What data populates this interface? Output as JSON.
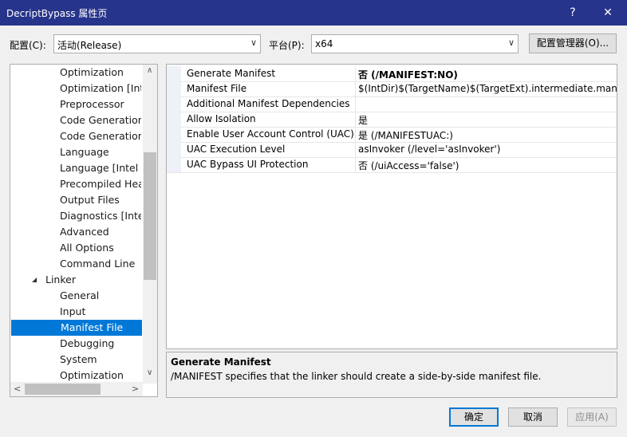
{
  "window": {
    "title": "DecriptBypass 属性页",
    "help_button": "?",
    "close_button": "✕"
  },
  "config": {
    "config_label": "配置(C):",
    "config_value": "活动(Release)",
    "platform_label": "平台(P):",
    "platform_value": "x64",
    "manager_button": "配置管理器(O)..."
  },
  "tree": {
    "items": [
      {
        "label": "Optimization",
        "indent": 2
      },
      {
        "label": "Optimization [Inte",
        "indent": 2
      },
      {
        "label": "Preprocessor",
        "indent": 2
      },
      {
        "label": "Code Generation",
        "indent": 2
      },
      {
        "label": "Code Generation",
        "indent": 2
      },
      {
        "label": "Language",
        "indent": 2
      },
      {
        "label": "Language [Intel C",
        "indent": 2
      },
      {
        "label": "Precompiled Head",
        "indent": 2
      },
      {
        "label": "Output Files",
        "indent": 2
      },
      {
        "label": "Diagnostics [Intel",
        "indent": 2
      },
      {
        "label": "Advanced",
        "indent": 2
      },
      {
        "label": "All Options",
        "indent": 2
      },
      {
        "label": "Command Line",
        "indent": 2
      },
      {
        "label": "Linker",
        "indent": 1,
        "expander": "◢"
      },
      {
        "label": "General",
        "indent": 2
      },
      {
        "label": "Input",
        "indent": 2
      },
      {
        "label": "Manifest File",
        "indent": 2,
        "selected": true
      },
      {
        "label": "Debugging",
        "indent": 2
      },
      {
        "label": "System",
        "indent": 2
      },
      {
        "label": "Optimization",
        "indent": 2
      }
    ]
  },
  "properties": [
    {
      "name": "Generate Manifest",
      "value": "否 (/MANIFEST:NO)",
      "bold": true
    },
    {
      "name": "Manifest File",
      "value": "$(IntDir)$(TargetName)$(TargetExt).intermediate.manifest"
    },
    {
      "name": "Additional Manifest Dependencies",
      "value": ""
    },
    {
      "name": "Allow Isolation",
      "value": "是"
    },
    {
      "name": "Enable User Account Control (UAC)",
      "value": "是 (/MANIFESTUAC:)"
    },
    {
      "name": "UAC Execution Level",
      "value": "asInvoker (/level='asInvoker')"
    },
    {
      "name": "UAC Bypass UI Protection",
      "value": "否 (/uiAccess='false')"
    }
  ],
  "description": {
    "title": "Generate Manifest",
    "text": "/MANIFEST specifies that the linker should create a side-by-side manifest file."
  },
  "buttons": {
    "ok": "确定",
    "cancel": "取消",
    "apply": "应用(A)"
  },
  "colors": {
    "titlebar": "#27348b",
    "selection": "#0078d7"
  }
}
